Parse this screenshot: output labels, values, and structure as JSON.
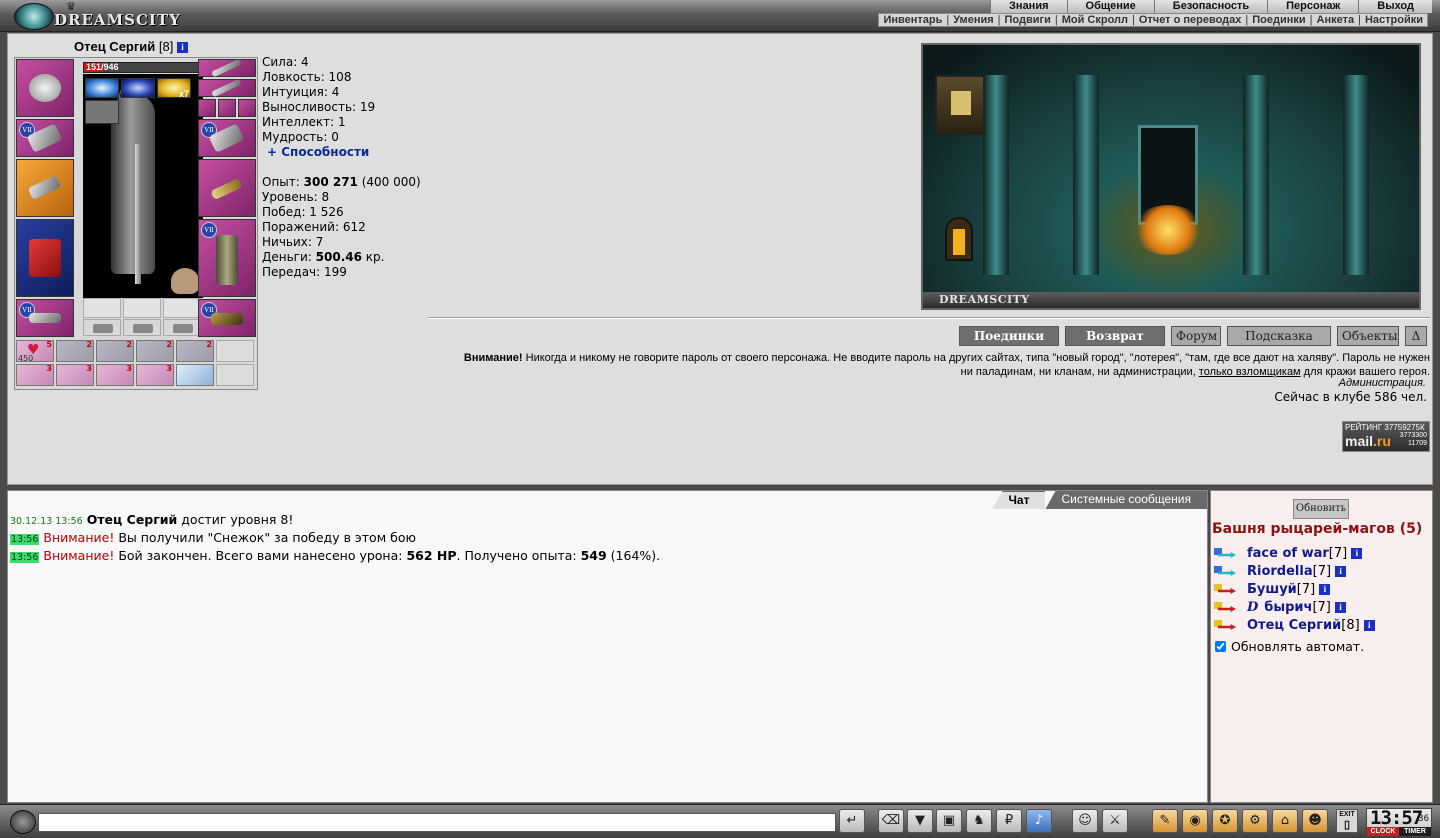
{
  "brand": {
    "name": "DREAMSCITY"
  },
  "menu": {
    "main": [
      "Знания",
      "Общение",
      "Безопасность",
      "Персонаж",
      "Выход"
    ],
    "sub": [
      "Инвентарь",
      "Умения",
      "Подвиги",
      "Мой Скролл",
      "Отчет о переводах",
      "Поединки",
      "Анкета",
      "Настройки"
    ]
  },
  "character": {
    "name": "Отец Сергий",
    "level_tag": "[8]",
    "hp_text": "151/946",
    "hp_fraction": 0.16,
    "effect_count": "x7",
    "pocket_count": "450"
  },
  "stats": {
    "lines": [
      "Сила: 4",
      "Ловкость: 108",
      "Интуиция: 4",
      "Выносливость: 19",
      "Интеллект: 1",
      "Мудрость: 0"
    ],
    "abilities_link": "+ Способности",
    "exp_label": "Опыт: ",
    "exp_value": "300 271",
    "exp_next": " (400 000)",
    "level_line": "Уровень: 8",
    "wins_line": "Побед: 1 526",
    "losses_line": "Поражений: 612",
    "draws_line": "Ничьих: 7",
    "money_label": "Деньги: ",
    "money_value": "500.46",
    "money_unit": " кр.",
    "transfers_line": "Передач: 199"
  },
  "location": {
    "brand": "DREAMSCITY",
    "progress": 1.0
  },
  "buttons": {
    "duels": "Поединки",
    "return": "Возврат",
    "forum": "Форум",
    "hint": "Подсказка",
    "objects": "Объекты",
    "delta": "Δ"
  },
  "warning": {
    "lead": "Внимание!",
    "text": " Никогда и никому не говорите пароль от своего персонажа. Не вводите пароль на других сайтах, типа \"новый город\", \"лотерея\", \"там, где все дают на халяву\". Пароль не нужен ни паладинам, ни кланам, ни администрации, ",
    "link": "только взломщикам",
    "tail": " для кражи вашего героя.",
    "sign": "Администрация."
  },
  "online": "Сейчас в клубе 586 чел.",
  "counter": {
    "line1": "РЕЙТИНГ 37759275К",
    "brand": "mail",
    "dot": ".ru",
    "line3a": "3773300",
    "line3b": "11709"
  },
  "chat": {
    "tabs": [
      "Чат",
      "Системные сообщения"
    ],
    "messages": [
      {
        "ts": "30.12.13 13:56",
        "name": "Отец Сергий",
        "text": " достиг уровня 8!"
      },
      {
        "ts": "13:56",
        "warn": "Внимание!",
        "text": " Вы получили \"Снежок\" за победу в этом бою"
      },
      {
        "ts": "13:56",
        "warn": "Внимание!",
        "text_a": " Бой закончен. Всего вами нанесено урона: ",
        "dmg": "562 HP",
        "text_b": ". Получено опыта: ",
        "exp": "549",
        "text_c": " (164%)."
      }
    ]
  },
  "room": {
    "refresh": "Обновить",
    "title": "Башня рыцарей-магов (5)",
    "users": [
      {
        "prefix": "",
        "name": "face of war",
        "lvl": "[7]",
        "color": "#1fb8c8"
      },
      {
        "prefix": "",
        "name": "Riordella",
        "lvl": "[7]",
        "color": "#1fb8c8"
      },
      {
        "prefix": "",
        "name": "Бушуй",
        "lvl": "[7]",
        "color": "#c81e1e"
      },
      {
        "prefix": "D",
        "name": "бырич",
        "lvl": "[7]",
        "color": "#c81e1e"
      },
      {
        "prefix": "",
        "name": "Отец Сергий",
        "lvl": "[8]",
        "color": "#c81e1e"
      }
    ],
    "auto_label": "Обновлять автомат."
  },
  "clock": {
    "time": "13:57",
    "sec": "36",
    "clock_label": "CLOCK",
    "timer_label": "TIMER",
    "exit": "EXIT"
  },
  "colors": {
    "accent": "#101a8a",
    "warning": "#c00000",
    "room_title": "#8c1414"
  }
}
